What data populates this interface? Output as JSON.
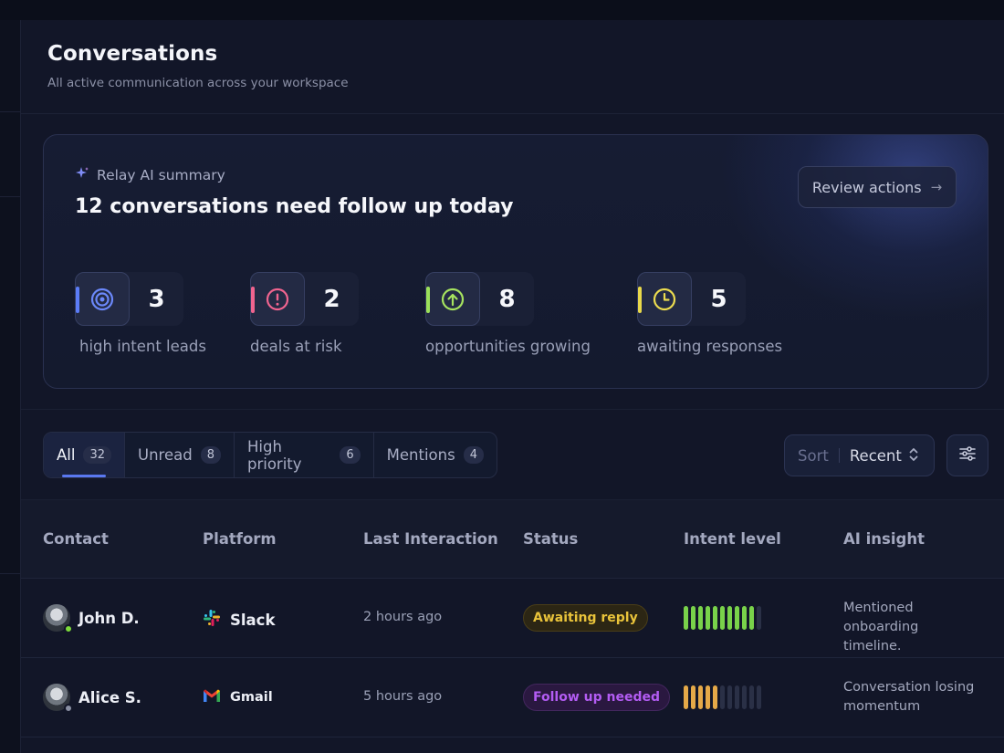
{
  "page": {
    "title": "Conversations",
    "subtitle": "All active communication across your workspace"
  },
  "ai_summary": {
    "label": "Relay AI summary",
    "icon": "sparkle-icon",
    "headline": "12 conversations need follow up today",
    "review_button": "Review actions",
    "review_arrow": "→",
    "metrics": [
      {
        "value": "3",
        "label": "high intent leads",
        "icon": "target-icon",
        "color": "#5b7cf7"
      },
      {
        "value": "2",
        "label": "deals at risk",
        "icon": "alert-icon",
        "color": "#f0648f"
      },
      {
        "value": "8",
        "label": "opportunities growing",
        "icon": "arrow-up-circle-icon",
        "color": "#9be05a"
      },
      {
        "value": "5",
        "label": "awaiting responses",
        "icon": "clock-icon",
        "color": "#e8d84a"
      }
    ]
  },
  "tabs": [
    {
      "label": "All",
      "count": "32",
      "active": true
    },
    {
      "label": "Unread",
      "count": "8",
      "active": false
    },
    {
      "label": "High priority",
      "count": "6",
      "active": false
    },
    {
      "label": "Mentions",
      "count": "4",
      "active": false
    }
  ],
  "sort": {
    "label": "Sort",
    "value": "Recent"
  },
  "filter_icon": "sliders-icon",
  "table": {
    "columns": [
      "Contact",
      "Platform",
      "Last Interaction",
      "Status",
      "Intent level",
      "AI insight"
    ],
    "rows": [
      {
        "contact": "John D.",
        "presence_color": "#7ddb3b",
        "platform": "Slack",
        "platform_icon": "slack-icon",
        "last_interaction": "2 hours ago",
        "status": "Awaiting reply",
        "status_color": "#e9c33a",
        "status_bg": "#2c2614",
        "intent_level": 10,
        "intent_max": 11,
        "intent_color": "#79d24a",
        "insight": "Mentioned onboarding timeline."
      },
      {
        "contact": "Alice S.",
        "presence_color": "#8a90a4",
        "platform": "Gmail",
        "platform_icon": "gmail-icon",
        "last_interaction": "5 hours ago",
        "status": "Follow up needed",
        "status_color": "#b35cf3",
        "status_bg": "#2a1840",
        "intent_level": 5,
        "intent_max": 11,
        "intent_color": "#e5a948",
        "insight": "Conversation losing momentum"
      }
    ]
  }
}
